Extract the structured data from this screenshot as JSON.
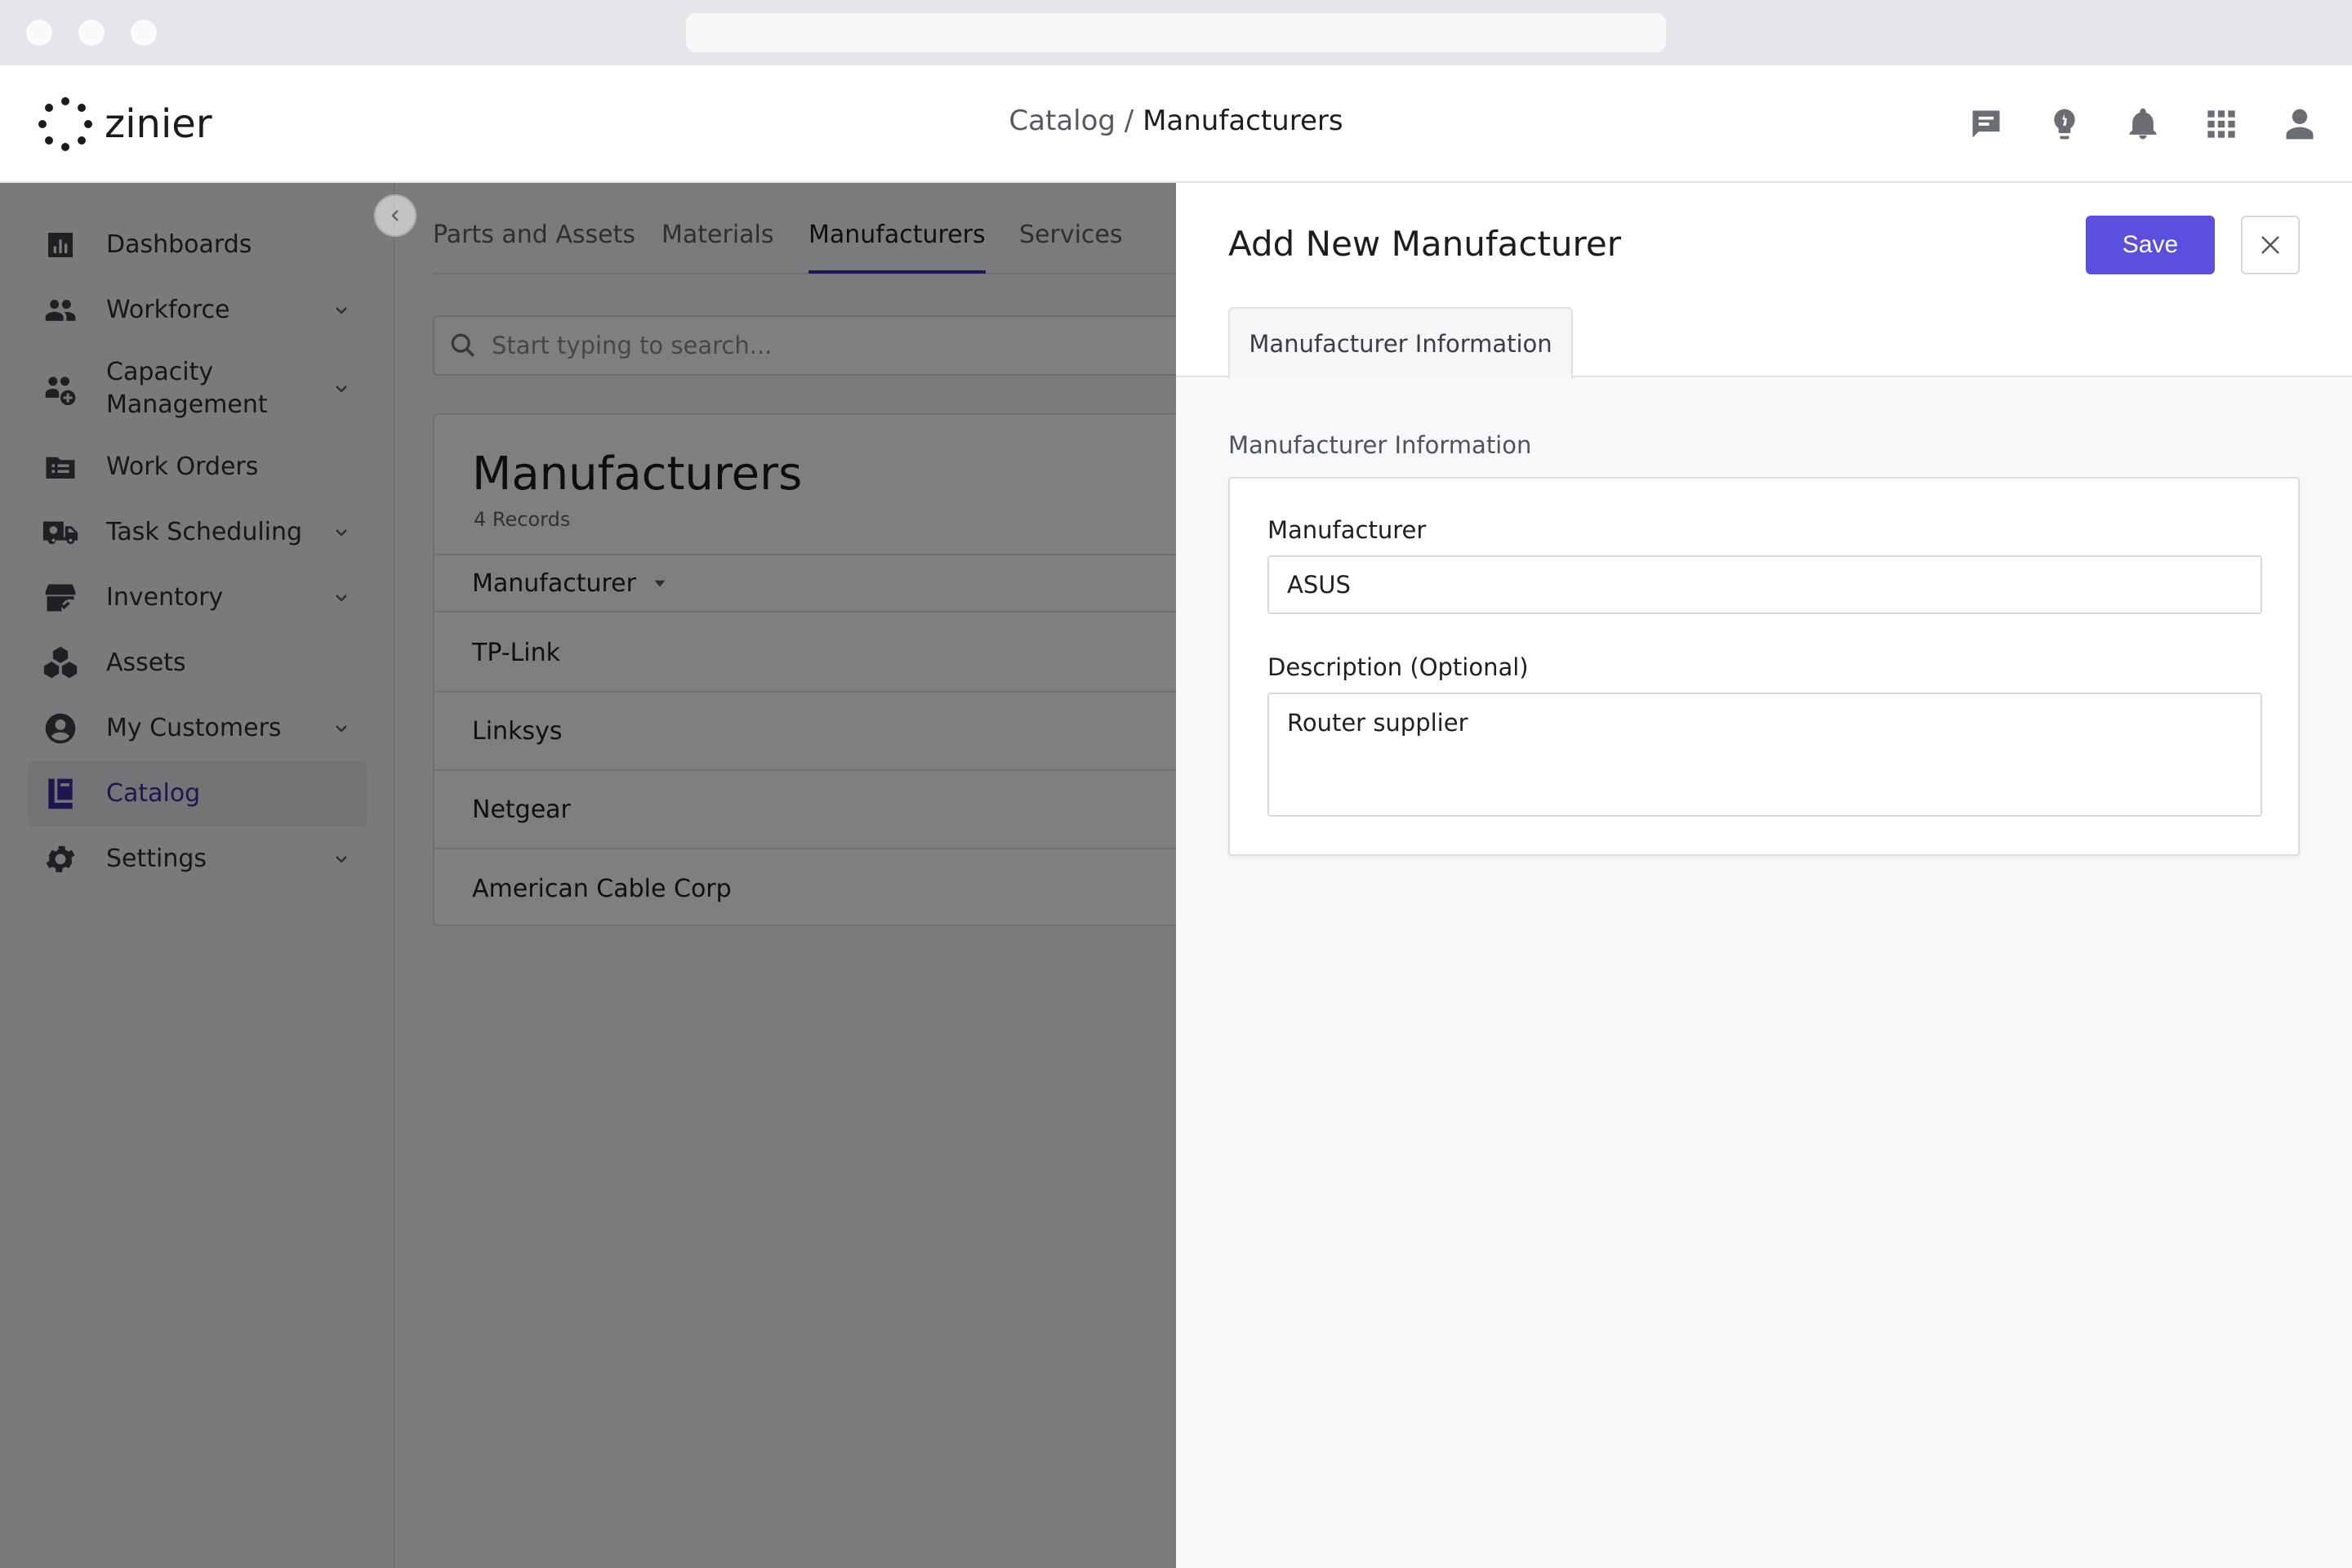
{
  "app": {
    "brand": "zinier"
  },
  "header": {
    "breadcrumb_root": "Catalog",
    "breadcrumb_sep": " / ",
    "breadcrumb_current": "Manufacturers",
    "icons": [
      "chat-icon",
      "lightbulb-icon",
      "bell-icon",
      "apps-grid-icon",
      "user-icon"
    ]
  },
  "sidebar": {
    "items": [
      {
        "label": "Dashboards",
        "icon": "bar-chart-icon",
        "has_chevron": false
      },
      {
        "label": "Workforce",
        "icon": "people-icon",
        "has_chevron": true
      },
      {
        "label": "Capacity Management",
        "icon": "capacity-icon",
        "has_chevron": true
      },
      {
        "label": "Work Orders",
        "icon": "work-orders-icon",
        "has_chevron": false
      },
      {
        "label": "Task Scheduling",
        "icon": "truck-icon",
        "has_chevron": true
      },
      {
        "label": "Inventory",
        "icon": "inventory-icon",
        "has_chevron": true
      },
      {
        "label": "Assets",
        "icon": "assets-icon",
        "has_chevron": false
      },
      {
        "label": "My Customers",
        "icon": "customer-icon",
        "has_chevron": true
      },
      {
        "label": "Catalog",
        "icon": "catalog-icon",
        "has_chevron": false,
        "active": true
      },
      {
        "label": "Settings",
        "icon": "gear-icon",
        "has_chevron": true
      }
    ]
  },
  "main": {
    "tabs": [
      {
        "label": "Parts and Assets"
      },
      {
        "label": "Materials"
      },
      {
        "label": "Manufacturers",
        "active": true
      },
      {
        "label": "Services"
      }
    ],
    "search_placeholder": "Start typing to search...",
    "list": {
      "title": "Manufacturers",
      "record_count": "4 Records",
      "column_header": "Manufacturer",
      "rows": [
        "TP-Link",
        "Linksys",
        "Netgear",
        "American Cable Corp"
      ]
    }
  },
  "drawer": {
    "title": "Add New Manufacturer",
    "save_label": "Save",
    "tab_label": "Manufacturer Information",
    "section_label": "Manufacturer Information",
    "fields": {
      "manufacturer_label": "Manufacturer",
      "manufacturer_value": "ASUS",
      "description_label": "Description (Optional)",
      "description_value": "Router supplier"
    }
  },
  "colors": {
    "accent": "#5b4fe0",
    "active_nav_text": "#3b2f9e",
    "overlay": "rgba(0,0,0,0.5)"
  }
}
